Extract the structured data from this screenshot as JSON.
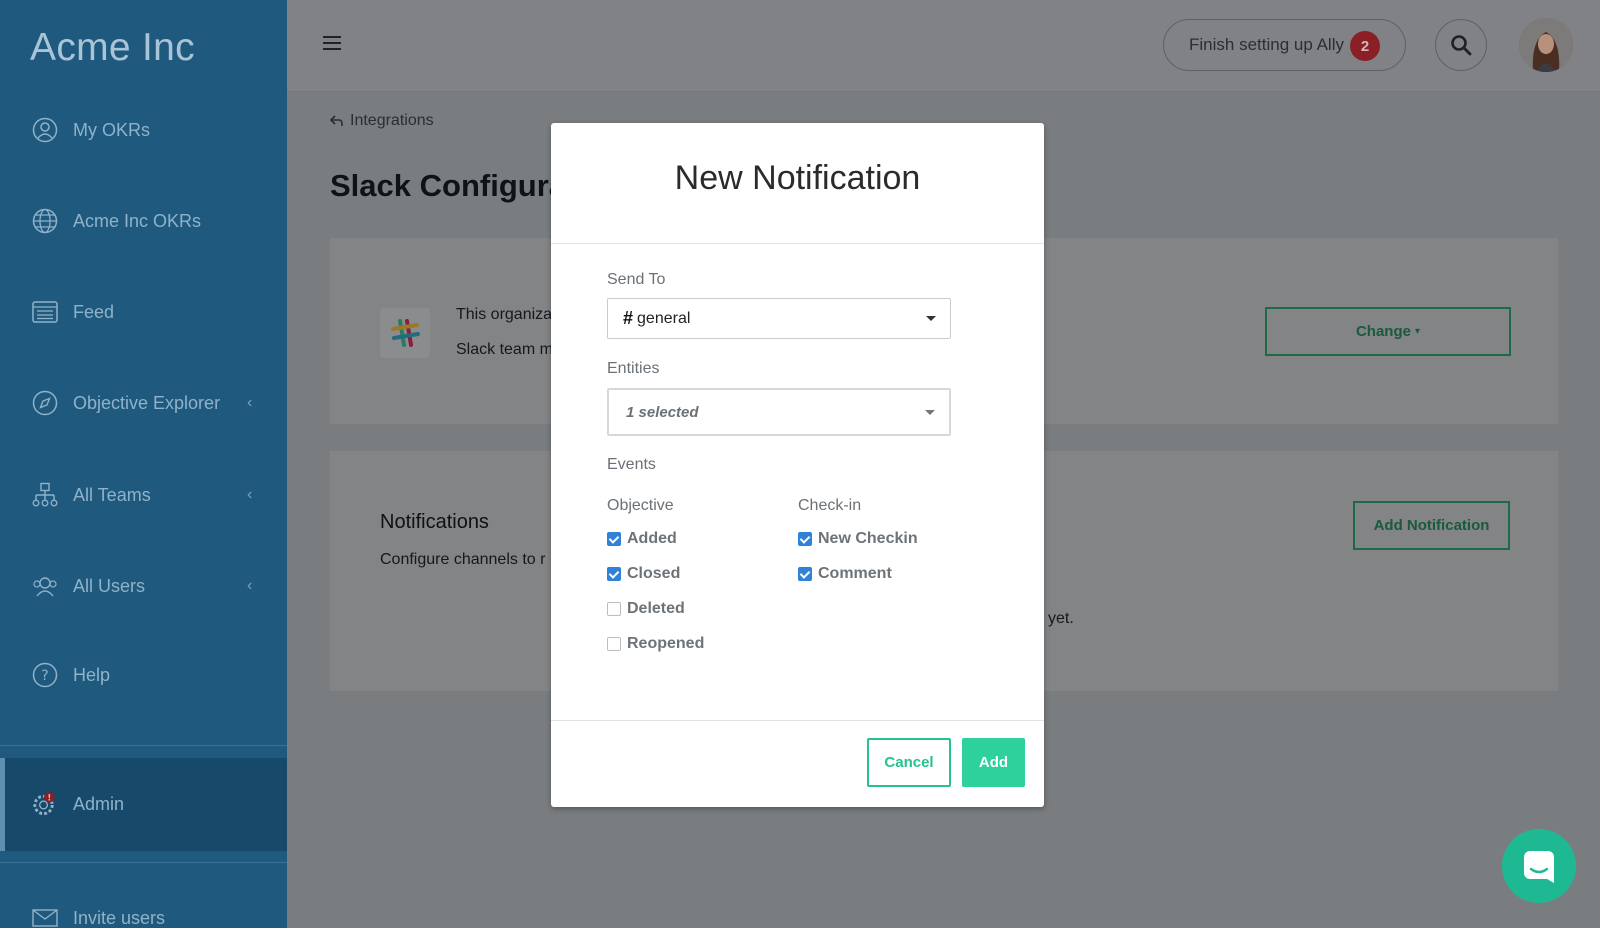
{
  "sidebar": {
    "brand": "Acme Inc",
    "items": [
      {
        "label": "My OKRs",
        "icon": "user-circle-icon"
      },
      {
        "label": "Acme Inc OKRs",
        "icon": "globe-icon"
      },
      {
        "label": "Feed",
        "icon": "feed-icon"
      },
      {
        "label": "Objective Explorer",
        "icon": "compass-icon"
      },
      {
        "label": "All Teams",
        "icon": "org-chart-icon"
      },
      {
        "label": "All Users",
        "icon": "users-icon"
      },
      {
        "label": "Help",
        "icon": "help-icon"
      },
      {
        "label": "Admin",
        "icon": "gear-alert-icon"
      },
      {
        "label": "Invite users",
        "icon": "mail-icon"
      }
    ]
  },
  "topbar": {
    "setup_label": "Finish setting up Ally",
    "setup_badge": "2"
  },
  "main": {
    "breadcrumb": "Integrations",
    "page_title": "Slack Configura",
    "card1_line1": "This organiza",
    "card1_line2": "Slack team m",
    "change_button": "Change",
    "notifications_title": "Notifications",
    "notifications_desc": "Configure channels to r",
    "empty_tail": "yet.",
    "add_notification_button": "Add Notification"
  },
  "modal": {
    "title": "New Notification",
    "send_to_label": "Send To",
    "send_to_value": "general",
    "entities_label": "Entities",
    "entities_value": "1 selected",
    "events_label": "Events",
    "objective_col": "Objective",
    "checkin_col": "Check-in",
    "objective_events": [
      {
        "label": "Added",
        "checked": true
      },
      {
        "label": "Closed",
        "checked": true
      },
      {
        "label": "Deleted",
        "checked": false
      },
      {
        "label": "Reopened",
        "checked": false
      }
    ],
    "checkin_events": [
      {
        "label": "New Checkin",
        "checked": true
      },
      {
        "label": "Comment",
        "checked": true
      }
    ],
    "cancel_label": "Cancel",
    "add_label": "Add"
  },
  "colors": {
    "sidebar_bg": "#1f5a7e",
    "accent_green": "#2ed09c",
    "checkbox_blue": "#2f82d8",
    "badge_red": "#8a1f25"
  }
}
